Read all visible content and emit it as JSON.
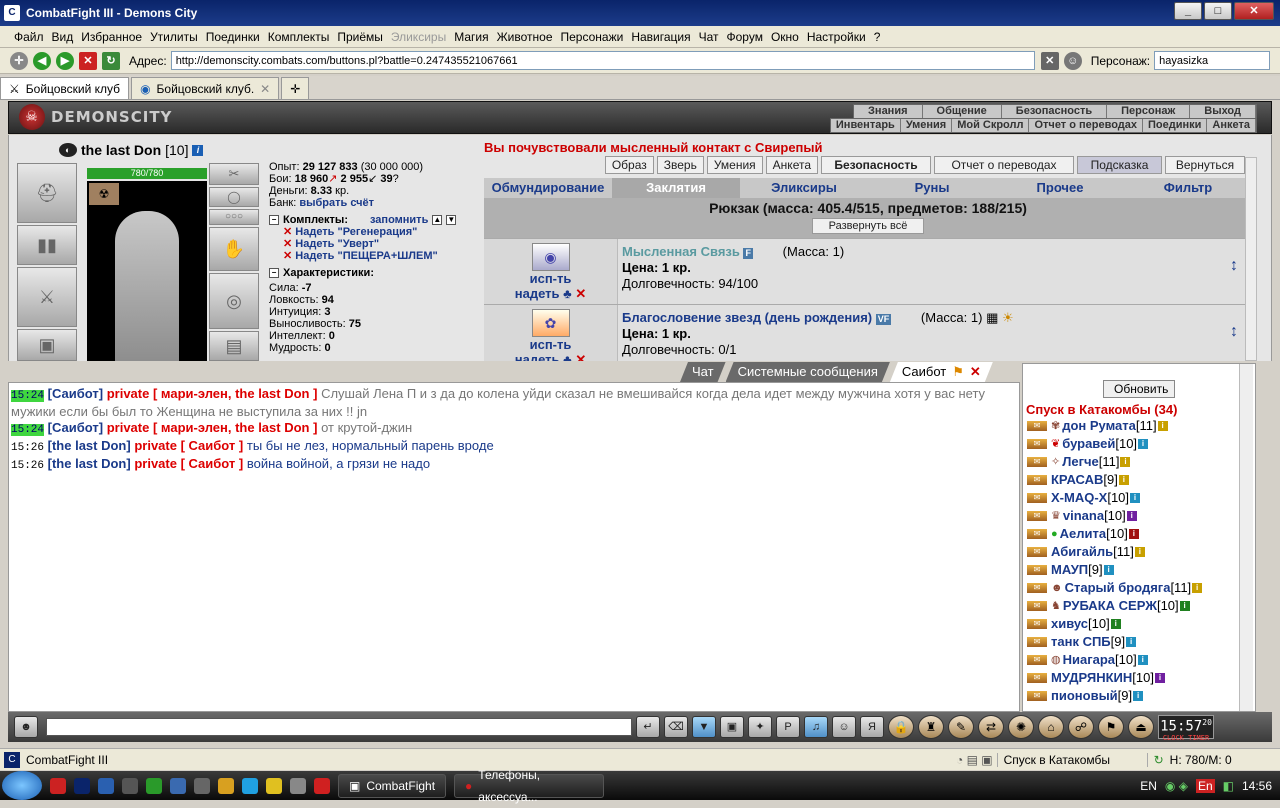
{
  "window": {
    "title": "CombatFight III - Demons City",
    "min": "_",
    "max": "□",
    "close": "✕"
  },
  "menu": [
    "Файл",
    "Вид",
    "Избранное",
    "Утилиты",
    "Поединки",
    "Комплекты",
    "Приёмы",
    "Эликсиры",
    "Магия",
    "Животное",
    "Персонажи",
    "Навигация",
    "Чат",
    "Форум",
    "Окно",
    "Настройки",
    "?"
  ],
  "address": {
    "label": "Адрес:",
    "url": "http://demonscity.combats.com/buttons.pl?battle=0.247435521067661",
    "persona_label": "Персонаж:",
    "persona": "hayasizka"
  },
  "tabs": [
    {
      "label": "Бойцовский клуб"
    },
    {
      "label": "Бойцовский клуб."
    }
  ],
  "header": {
    "logo": "DEMONSCITY",
    "top_links": [
      "Знания",
      "Общение",
      "Безопасность",
      "Персонаж",
      "Выход"
    ],
    "sub_links": [
      "Инвентарь",
      "Умения",
      "Мой Скролл",
      "Отчет о переводах",
      "Поединки",
      "Анкета"
    ]
  },
  "character": {
    "name": "the last Don",
    "level": "[10]",
    "hp": "780/780",
    "hp_fraction": 1.0,
    "exp_label": "Опыт:",
    "exp": "29 127 833",
    "exp_next": "(30 000 000)",
    "battles_label": "Бои:",
    "wins": "18 960",
    "losses": "2 955",
    "draws": "39",
    "money_label": "Деньги:",
    "money": "8.33",
    "money_unit": "кр.",
    "bank_label": "Банк:",
    "bank_link": "выбрать счёт",
    "sets_label": "Комплекты:",
    "sets_remember": "запомнить",
    "sets": [
      "Надеть \"Регенерация\"",
      "Надеть \"Уверт\"",
      "Надеть \"ПЕЩЕРА+ШЛЕМ\""
    ],
    "chars_label": "Характеристики:",
    "stats": [
      {
        "name": "Сила:",
        "value": "-7"
      },
      {
        "name": "Ловкость:",
        "value": "94"
      },
      {
        "name": "Интуиция:",
        "value": "3"
      },
      {
        "name": "Выносливость:",
        "value": "75"
      },
      {
        "name": "Интеллект:",
        "value": "0"
      },
      {
        "name": "Мудрость:",
        "value": "0"
      }
    ]
  },
  "inventory": {
    "mind_message": "Вы почувствовали мысленный контакт с Свирепый",
    "buttons": [
      "Образ",
      "Зверь",
      "Умения",
      "Анкета",
      "Безопасность",
      "Отчет о переводах",
      "Подсказка",
      "Вернуться"
    ],
    "tabs": [
      "Обмундирование",
      "Заклятия",
      "Эликсиры",
      "Руны",
      "Прочее",
      "Фильтр"
    ],
    "active_tab": 1,
    "backpack": "Рюкзак (масса: 405.4/515, предметов: 188/215)",
    "expand_all": "Развернуть всё",
    "items": [
      {
        "name": "Мысленная Связь",
        "tag": "F",
        "mass": "(Масса: 1)",
        "price_label": "Цена:",
        "price": "1 кр.",
        "dur_label": "Долговечность:",
        "dur": "94/100",
        "use": "исп-ть",
        "wear": "надеть"
      },
      {
        "name": "Благословение звезд (день рождения)",
        "tag": "VF",
        "mass": "(Масса: 1)",
        "price_label": "Цена:",
        "price": "1 кр.",
        "dur_label": "Долговечность:",
        "dur": "0/1",
        "use": "исп-ть",
        "wear": "надеть"
      }
    ]
  },
  "chat": {
    "tabs": [
      "Чат",
      "Системные сообщения",
      "Саибот"
    ],
    "messages": [
      {
        "time": "15:24",
        "who": "[Саибот]",
        "priv": "private [ мари-элен, the last Don ]",
        "text": "Слушай Лена П и з да до колена уйди сказал не вмешивайся когда дела идет между мужчина хотя у вас нету мужики если бы был то Женщина не выступила за них !! jn"
      },
      {
        "time": "15:24",
        "who": "[Саибот]",
        "priv": "private [ мари-элен, the last Don ]",
        "text": "от крутой-джин"
      },
      {
        "time": "15:26",
        "who": "[the last Don]",
        "priv": "private [ Саибот ]",
        "text": "ты бы не лез, нормальный парень вроде"
      },
      {
        "time": "15:26",
        "who": "[the last Don]",
        "priv": "private [ Саибот ]",
        "text": "война войной, а грязи не надо"
      }
    ]
  },
  "online": {
    "refresh": "Обновить",
    "location": "Спуск в Катакомбы (34)",
    "players": [
      {
        "name": "дон Румата",
        "level": "[11]"
      },
      {
        "name": "буравей",
        "level": "[10]"
      },
      {
        "name": "Легче",
        "level": "[11]"
      },
      {
        "name": "КРАСАВ",
        "level": "[9]"
      },
      {
        "name": "X-MAQ-X",
        "level": "[10]"
      },
      {
        "name": "vinana",
        "level": "[10]"
      },
      {
        "name": "Аелита",
        "level": "[10]"
      },
      {
        "name": "Абигайль",
        "level": "[11]"
      },
      {
        "name": "МАУП",
        "level": "[9]"
      },
      {
        "name": "Старый бродяга",
        "level": "[11]"
      },
      {
        "name": "РУБАКА СЕРЖ",
        "level": "[10]"
      },
      {
        "name": "хивус",
        "level": "[10]"
      },
      {
        "name": "танк СПБ",
        "level": "[9]"
      },
      {
        "name": "Ниагара",
        "level": "[10]"
      },
      {
        "name": "МУДРЯНКИН",
        "level": "[10]"
      },
      {
        "name": "пионовый",
        "level": "[9]"
      }
    ]
  },
  "clock": {
    "time": "15:57",
    "sec": "20",
    "label": "CLOCK TIMER"
  },
  "status": {
    "app": "CombatFight III",
    "location": "Спуск в Катакомбы",
    "hm": "H: 780/M: 0"
  },
  "taskbar": {
    "task1": "CombatFight",
    "task2": "Телефоны, аксессуа...",
    "lang": "EN",
    "lang2": "En",
    "time": "14:56"
  }
}
